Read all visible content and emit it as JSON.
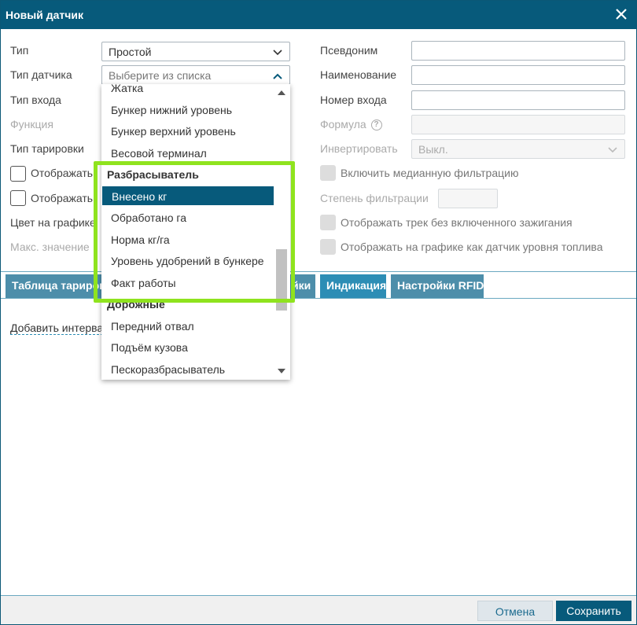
{
  "dialog": {
    "title": "Новый датчик"
  },
  "left": {
    "type_label": "Тип",
    "type_value": "Простой",
    "sensor_type_label": "Тип датчика",
    "sensor_type_placeholder": "Выберите из списка",
    "input_type_label": "Тип входа",
    "function_label": "Функция",
    "calibration_label": "Тип тарировки",
    "show_cb1_label": "Отображать",
    "show_cb2_label": "Отображать",
    "chart_color_label": "Цвет на графике",
    "max_value_label": "Макс. значение"
  },
  "right": {
    "alias_label": "Псевдоним",
    "name_label": "Наименование",
    "input_number_label": "Номер входа",
    "formula_label": "Формула",
    "formula_help": "?",
    "invert_label": "Инвертировать",
    "invert_value": "Выкл.",
    "median_filter_label": "Включить медианную фильтрацию",
    "filter_degree_label": "Степень фильтрации",
    "track_without_ignition_label": "Отображать трек без включенного зажигания",
    "fuel_level_label": "Отображать на графике как датчик уровня топлива"
  },
  "tabs": [
    {
      "label": "Таблица тарировки"
    },
    {
      "label": "йки"
    },
    {
      "label": "Индикация"
    },
    {
      "label": "Настройки RFID"
    }
  ],
  "tab_content": {
    "add_interval_link": "Добавить интерва"
  },
  "dropdown": {
    "items": [
      {
        "label": "Жатка",
        "group": false,
        "selected": false
      },
      {
        "label": "Бункер нижний уровень",
        "group": false,
        "selected": false
      },
      {
        "label": "Бункер верхний уровень",
        "group": false,
        "selected": false
      },
      {
        "label": "Весовой терминал",
        "group": false,
        "selected": false
      },
      {
        "label": "Разбрасыватель",
        "group": true,
        "selected": false
      },
      {
        "label": "Внесено кг",
        "group": false,
        "selected": true
      },
      {
        "label": "Обработано га",
        "group": false,
        "selected": false
      },
      {
        "label": "Норма кг/га",
        "group": false,
        "selected": false
      },
      {
        "label": "Уровень удобрений в бункере",
        "group": false,
        "selected": false
      },
      {
        "label": "Факт работы",
        "group": false,
        "selected": false
      },
      {
        "label": "Дорожные",
        "group": true,
        "selected": false
      },
      {
        "label": "Передний отвал",
        "group": false,
        "selected": false
      },
      {
        "label": "Подъём кузова",
        "group": false,
        "selected": false
      },
      {
        "label": "Пескоразбрасыватель",
        "group": false,
        "selected": false
      }
    ]
  },
  "footer": {
    "cancel_label": "Отмена",
    "save_label": "Сохранить"
  },
  "colors": {
    "header": "#075a7b",
    "highlight": "#8fe31e",
    "selected": "#075a7b"
  }
}
